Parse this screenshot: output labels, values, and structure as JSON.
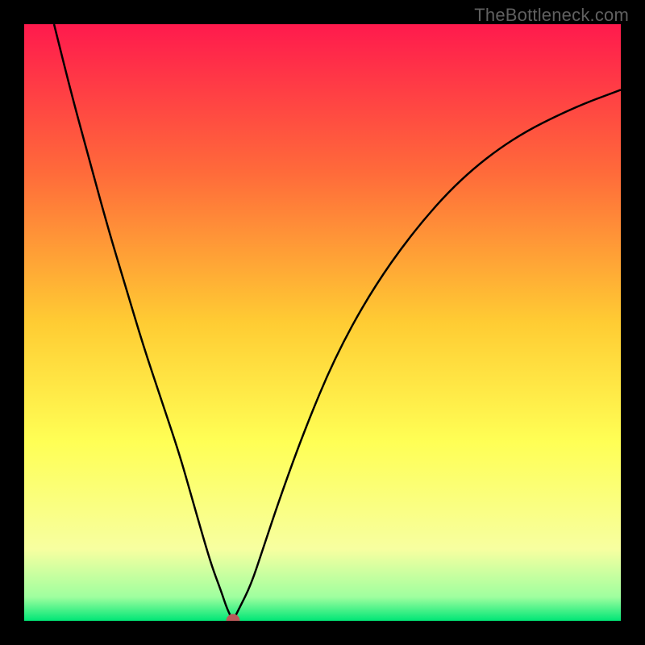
{
  "watermark": "TheBottleneck.com",
  "chart_data": {
    "type": "line",
    "title": "",
    "xlabel": "",
    "ylabel": "",
    "xlim": [
      0,
      100
    ],
    "ylim": [
      0,
      100
    ],
    "gradient_stops": [
      {
        "offset": 0,
        "color": "#ff1a4d"
      },
      {
        "offset": 25,
        "color": "#ff6b3a"
      },
      {
        "offset": 50,
        "color": "#ffcc33"
      },
      {
        "offset": 70,
        "color": "#ffff55"
      },
      {
        "offset": 88,
        "color": "#f7ffa0"
      },
      {
        "offset": 96,
        "color": "#9fff9f"
      },
      {
        "offset": 100,
        "color": "#00e676"
      }
    ],
    "series": [
      {
        "name": "bottleneck-curve",
        "x": [
          5,
          8,
          11,
          14,
          17,
          20,
          23,
          26,
          28,
          30,
          31.5,
          33,
          34,
          35,
          36,
          38,
          40,
          43,
          47,
          52,
          58,
          65,
          73,
          82,
          92,
          100
        ],
        "y": [
          100,
          88,
          77,
          66,
          56,
          46,
          37,
          28,
          21,
          14,
          9,
          5,
          2,
          0,
          2,
          6,
          12,
          21,
          32,
          44,
          55,
          65,
          74,
          81,
          86,
          89
        ]
      }
    ],
    "marker": {
      "x": 35,
      "y": 0,
      "color": "#bb5a5a"
    }
  }
}
